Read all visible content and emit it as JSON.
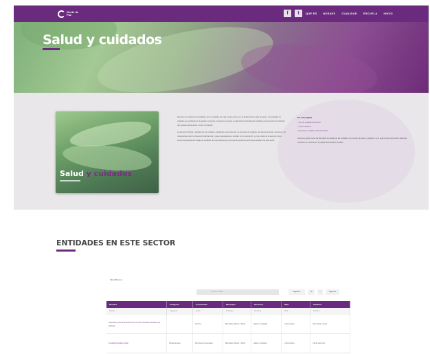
{
  "header": {
    "logo_text": "Gente de\nPaz",
    "social": [
      {
        "icon": "facebook-icon",
        "glyph": "f"
      },
      {
        "icon": "twitter-icon",
        "glyph": "t"
      }
    ],
    "nav": [
      "QUE ES",
      "NOSAES",
      "CUALIDAD",
      "ESCUELA",
      "INICIO"
    ]
  },
  "hero": {
    "title": "Salud y cuidados"
  },
  "book": {
    "title_part1": "Salud",
    "title_part2": "y cuidados"
  },
  "intro": {
    "paragraph1": "El sector de la Salud o los Cuidados, de los cuidados. Es más, ningún terreno en el ámbito de las redes de apoyo, comunidades de cuidados que participan en la gestión; el acceso, resolver a la usuaria, la adaptación del trabajo de cuidados y la protección de prácticas que respetan el bienestar común compartido.",
    "paragraph2": "La Economía Social y solidaria de los cuidados, atendiendo a las personas y a personas de cuidados, al sistema de salud, al acceso y de cooperativas sobre la dimensión pública local, y para cooperativas en sanidad, en la prevención, y en la cultura de la atención, de la economía solidaria del trabajo de cuidados, de importancia que importa a las personas del enfoque solidario de este sector.",
    "sidebar_heading": "En esta página",
    "sidebar_links": [
      "Tipo de entidades del sector",
      "Cómo colaborar",
      "Recursos y material / Documentación"
    ],
    "sidebar_note": "Siempre pueden verse las Mercados de trabajo de las entidades en el sector de salud y cuidados. Si en algo buscas información adicional, contacta con nosotras en la página de Mercados Sociales."
  },
  "sector": {
    "title": "ENTIDADES EN ESTE SECTOR"
  },
  "table_controls": {
    "filter_label": "Filtrar/Buscar",
    "search_placeholder": "Buscar entidad...",
    "pager": [
      "Registros",
      "10",
      "1",
      "Siguiente"
    ]
  },
  "table": {
    "headers": [
      "Nombre",
      "Categoría",
      "Comunidad",
      "Municipio",
      "Servicios",
      "Web",
      "Teléfono"
    ],
    "filters": [
      "Nombre",
      "Categoría",
      "Todas",
      "Municipio",
      "Servicios",
      "Web",
      "Teléfono"
    ],
    "rows": [
      [
        "Asociación para la Atención de los Grupos Sociales Excluidos por Adicción",
        "",
        "Otra f.a.",
        "Municipio alfonso o Nuño",
        "Salud y Cuidados",
        "+ Información",
        "Información social"
      ],
      [
        "Fundación Equipo Social",
        "Pluriempresas",
        "Personas Comunitaria",
        "Municipio alfonso y Nuño",
        "Salud y cuidados",
        "+ Información",
        "Vía de Atención"
      ]
    ]
  }
}
